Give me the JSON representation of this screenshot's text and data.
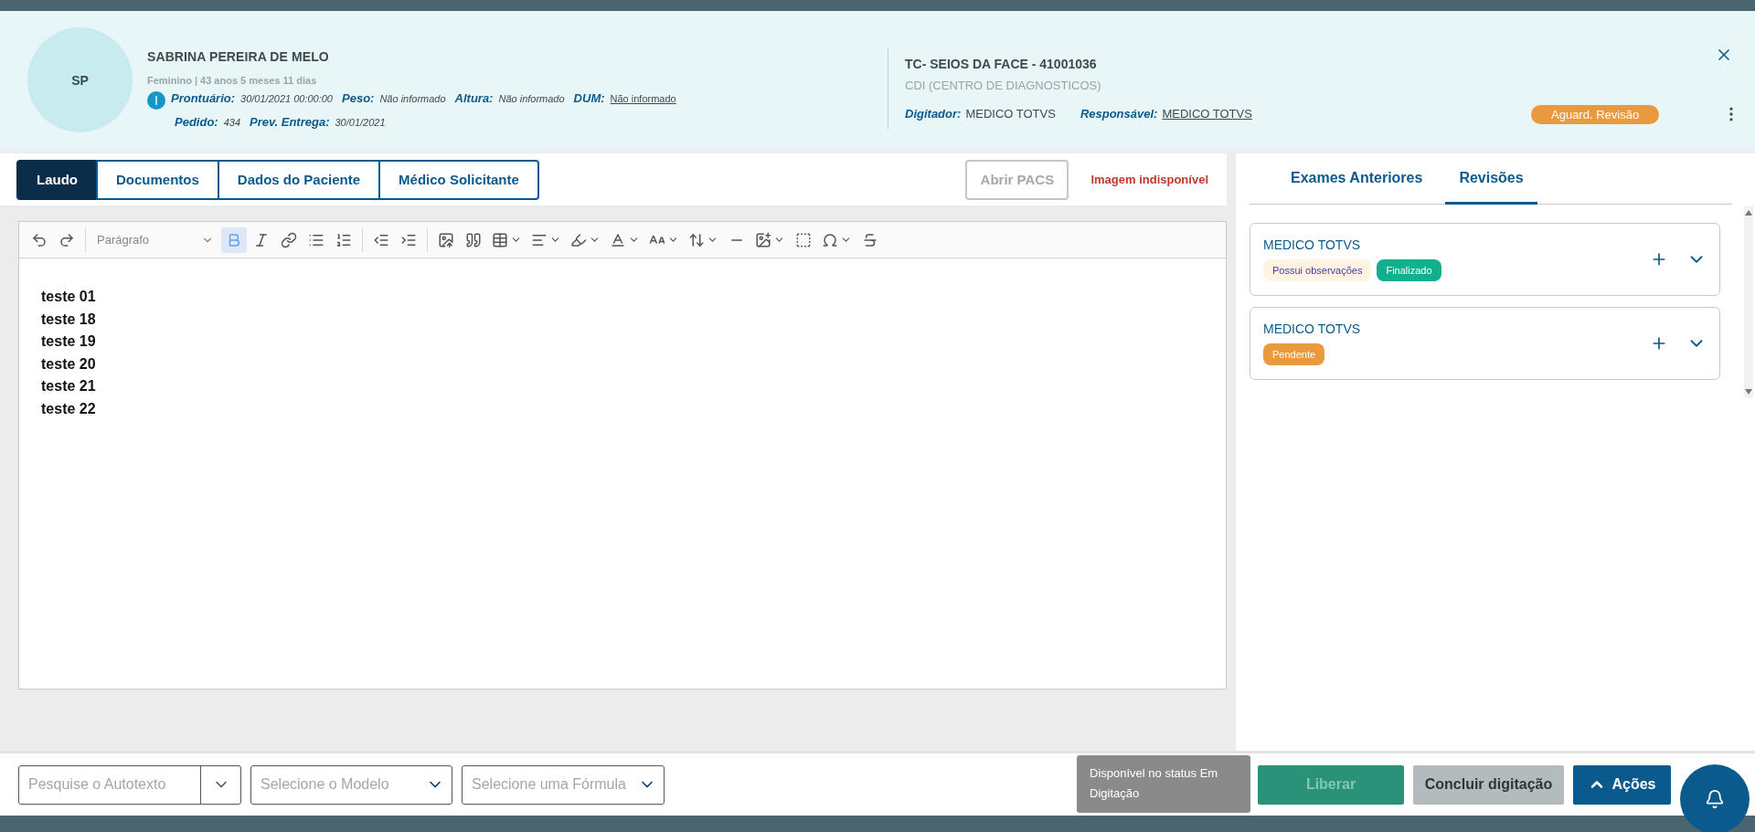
{
  "patient": {
    "initials": "SP",
    "name": "SABRINA PEREIRA DE MELO",
    "summary": "Feminino | 43 anos 5 meses 11 dias",
    "fields": [
      {
        "label": "Prontuário:",
        "value": "30/01/2021 00:00:00",
        "link": false
      },
      {
        "label": "Peso:",
        "value": "Não informado",
        "link": false
      },
      {
        "label": "Altura:",
        "value": "Não informado",
        "link": false
      },
      {
        "label": "DUM:",
        "value": "Não informado",
        "link": true
      }
    ],
    "fields_2": [
      {
        "label": "Pedido:",
        "value": "434",
        "link": false
      },
      {
        "label": "Prev. Entrega:",
        "value": "30/01/2021",
        "link": false
      }
    ]
  },
  "exam": {
    "title": "TC- SEIOS DA FACE - 41001036",
    "unit": "CDI (CENTRO DE DIAGNOSTICOS)",
    "people": [
      {
        "label": "Digitador:",
        "value": "MEDICO TOTVS",
        "link": false
      },
      {
        "label": "Responsável:",
        "value": "MEDICO TOTVS",
        "link": true
      }
    ],
    "status": "Aguard. Revisão"
  },
  "tabs": [
    {
      "label": "Laudo",
      "selected": true
    },
    {
      "label": "Documentos",
      "selected": false
    },
    {
      "label": "Dados do Paciente",
      "selected": false
    },
    {
      "label": "Médico Solicitante",
      "selected": false
    }
  ],
  "pacs_button": {
    "label": "Abrir PACS",
    "disabled": true
  },
  "image_status": "Imagem indisponível",
  "editor": {
    "block_format": "Parágrafo",
    "bold_active": true,
    "lines": [
      "teste 01",
      "teste 18",
      "teste 19",
      "teste 20",
      "teste 21",
      "teste 22"
    ]
  },
  "side_tabs": [
    {
      "label": "Exames Anteriores",
      "selected": false
    },
    {
      "label": "Revisões",
      "selected": true
    }
  ],
  "reviews": [
    {
      "name": "MEDICO TOTVS",
      "tags": [
        {
          "label": "Possui observações",
          "kind": "note"
        },
        {
          "label": "Finalizado",
          "kind": "done"
        }
      ]
    },
    {
      "name": "MEDICO TOTVS",
      "tags": [
        {
          "label": "Pendente",
          "kind": "pending"
        }
      ]
    }
  ],
  "footer": {
    "selects": [
      {
        "placeholder": "Pesquise o Autotexto",
        "kind": "search"
      },
      {
        "placeholder": "Selecione o Modelo",
        "kind": "select"
      },
      {
        "placeholder": "Selecione uma Fórmula",
        "kind": "select"
      }
    ],
    "tooltip": "Disponível no status Em Digitação",
    "buttons": [
      {
        "label": "Liberar",
        "kind": "release"
      },
      {
        "label": "Concluir digitação",
        "kind": "finish"
      },
      {
        "label": "Ações",
        "kind": "actions"
      }
    ]
  }
}
